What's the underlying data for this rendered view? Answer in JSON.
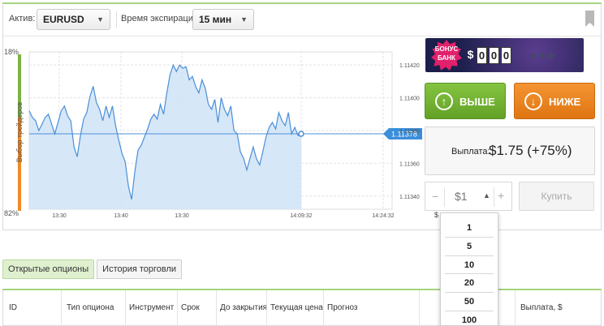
{
  "toolbar": {
    "asset_label": "Актив:",
    "asset_value": "EURUSD",
    "expiry_label": "Время экспирации:",
    "expiry_value": "15 мин",
    "caret": "▼"
  },
  "chart": {
    "top_percent": "18%",
    "bottom_percent": "82%",
    "side_label": "Выбор трейдеров",
    "current_price": "1.11378",
    "colors": {
      "line": "#4a8fd8",
      "fill": "#cfe3f7",
      "buyers": "#7cb342",
      "sellers": "#f08a24",
      "price_tag": "#3a8edb"
    }
  },
  "chart_data": {
    "type": "area",
    "title": "",
    "xlabel": "",
    "ylabel": "",
    "x_ticks": [
      "13:30",
      "13:40",
      "13:30",
      "14:09:32",
      "14:24:32"
    ],
    "y_ticks": [
      "1.11420",
      "1.11400",
      "1.11380",
      "1.11360",
      "1.11340"
    ],
    "ylim": [
      1.11332,
      1.11428
    ],
    "grid": true,
    "series": [
      {
        "values": [
          1.11392,
          1.11388,
          1.11386,
          1.1138,
          1.11384,
          1.11388,
          1.1139,
          1.11384,
          1.11378,
          1.11385,
          1.11392,
          1.11395,
          1.11389,
          1.11386,
          1.1137,
          1.11364,
          1.11377,
          1.11387,
          1.11391,
          1.11401,
          1.11407,
          1.11397,
          1.11393,
          1.11386,
          1.11395,
          1.11388,
          1.11395,
          1.11383,
          1.11374,
          1.11366,
          1.11361,
          1.11346,
          1.11338,
          1.11355,
          1.11368,
          1.11371,
          1.11376,
          1.11381,
          1.11387,
          1.1139,
          1.11387,
          1.11396,
          1.1139,
          1.11403,
          1.11414,
          1.1142,
          1.11416,
          1.1142,
          1.11418,
          1.11419,
          1.11411,
          1.11413,
          1.11407,
          1.11403,
          1.11411,
          1.11406,
          1.11396,
          1.11393,
          1.11399,
          1.11385,
          1.114,
          1.11393,
          1.11389,
          1.11395,
          1.1138,
          1.11378,
          1.11367,
          1.11363,
          1.11356,
          1.11363,
          1.1137,
          1.11363,
          1.11359,
          1.11367,
          1.11376,
          1.11382,
          1.11385,
          1.11381,
          1.11391,
          1.11386,
          1.11383,
          1.11391,
          1.11378,
          1.11382,
          1.11377,
          1.11378
        ],
        "current": 1.11378
      }
    ]
  },
  "bonus": {
    "badge_line1": "БОНУС",
    "badge_line2": "БАНК",
    "currency": "$",
    "digits": [
      "0",
      "0",
      "0"
    ],
    "stars": "★★★"
  },
  "trade": {
    "up_label": "ВЫШЕ",
    "down_label": "НИЖЕ",
    "up_icon": "↑",
    "down_icon": "↓",
    "payout_label": "Выплата:",
    "payout_value": "$1.75 (+75%)",
    "minus": "−",
    "amount_value": "$1",
    "amount_arrow": "▲",
    "plus": "+",
    "buy_label": "Купить",
    "currency_under": "$"
  },
  "amount_dropdown": [
    "1",
    "5",
    "10",
    "20",
    "50",
    "100"
  ],
  "tabs": [
    {
      "label": "Открытые опционы"
    },
    {
      "label": "История торговли"
    }
  ],
  "table": {
    "columns": [
      "ID",
      "Тип опциона",
      "Инструмент",
      "Срок",
      "До закрытия",
      "Текущая цена",
      "Прогноз",
      "Выплата, $"
    ]
  }
}
